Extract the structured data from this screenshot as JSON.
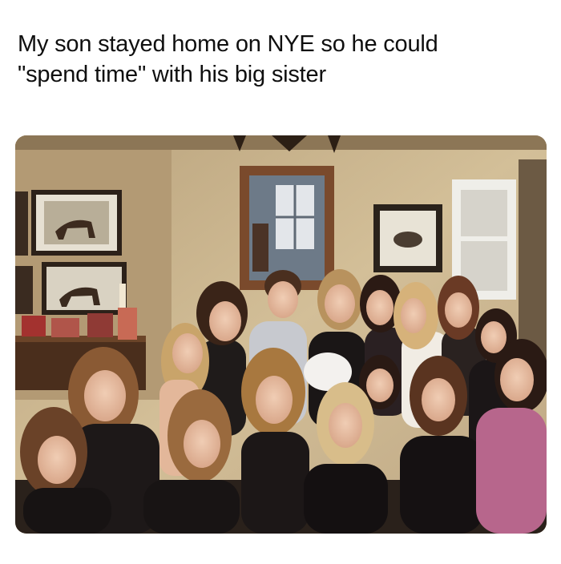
{
  "post": {
    "caption_lines": [
      "My son stayed home on NYE so he could",
      "\"spend time\" with his big sister"
    ]
  },
  "photo": {
    "subject": "group-photo",
    "colors": {
      "wall": "#c9b48e",
      "wall_shadow": "#8f7d5f",
      "mirror_frame": "#7a4a2c",
      "dark_clothing": "#1a1515",
      "skin": "#e3b79a",
      "hair_brown": "#6a4228",
      "hair_blonde": "#c9a46a",
      "pink_dress": "#b7668c"
    }
  }
}
